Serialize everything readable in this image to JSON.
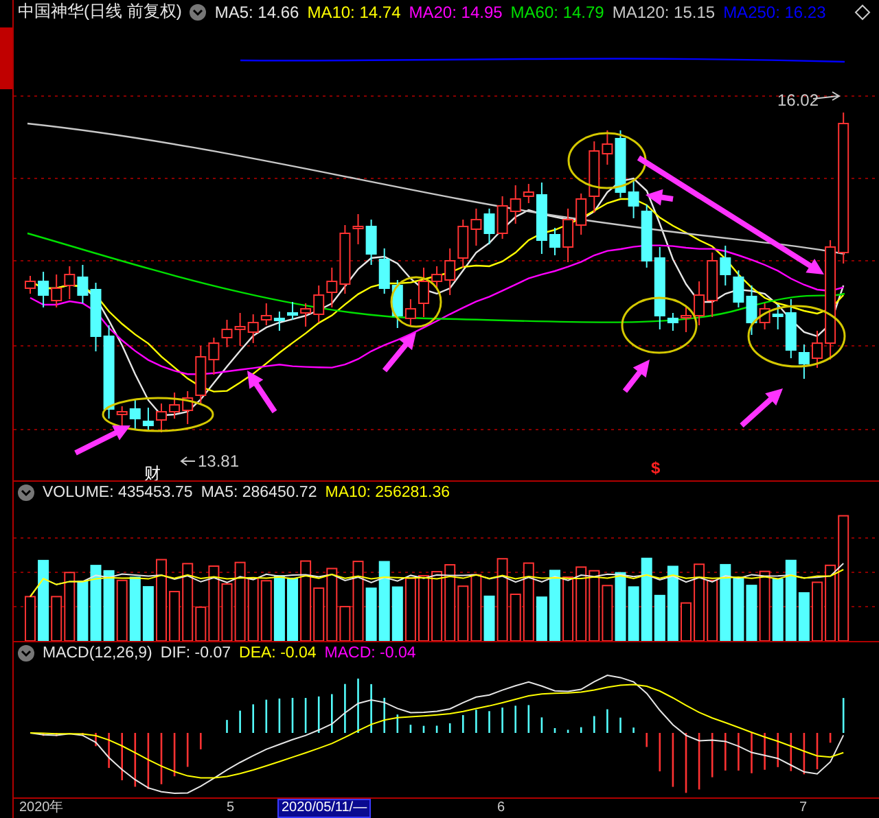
{
  "header": {
    "title": "中国神华(日线 前复权)",
    "indicators": [
      {
        "text": "MA5: 14.66",
        "color": "#e6e6e6"
      },
      {
        "text": "MA10: 14.74",
        "color": "#ffff00"
      },
      {
        "text": "MA20: 14.95",
        "color": "#ff00ff"
      },
      {
        "text": "MA60: 14.79",
        "color": "#00e000"
      },
      {
        "text": "MA120: 15.15",
        "color": "#c8c8c8"
      },
      {
        "text": "MA250: 16.23",
        "color": "#0000ff"
      }
    ]
  },
  "price_chart": {
    "high_label": "16.02",
    "low_label": "13.81",
    "markers": [
      {
        "kind": "finance",
        "text": "财"
      },
      {
        "kind": "dividend",
        "text": "$"
      }
    ]
  },
  "volume": {
    "indicators": [
      {
        "text": "VOLUME: 435453.75",
        "color": "#e6e6e6"
      },
      {
        "text": "MA5: 286450.72",
        "color": "#e6e6e6"
      },
      {
        "text": "MA10: 256281.36",
        "color": "#ffff00"
      }
    ]
  },
  "macd": {
    "indicators": [
      {
        "text": "MACD(12,26,9)",
        "color": "#e6e6e6"
      },
      {
        "text": "DIF: -0.07",
        "color": "#e6e6e6"
      },
      {
        "text": "DEA: -0.04",
        "color": "#ffff00"
      },
      {
        "text": "MACD: -0.04",
        "color": "#ff00ff"
      }
    ]
  },
  "time_axis": [
    {
      "label": "2020年",
      "selected": false
    },
    {
      "label": "5",
      "selected": false
    },
    {
      "label": "2020/05/11/—",
      "selected": true
    },
    {
      "label": "6",
      "selected": false
    },
    {
      "label": "7",
      "selected": false
    }
  ]
}
